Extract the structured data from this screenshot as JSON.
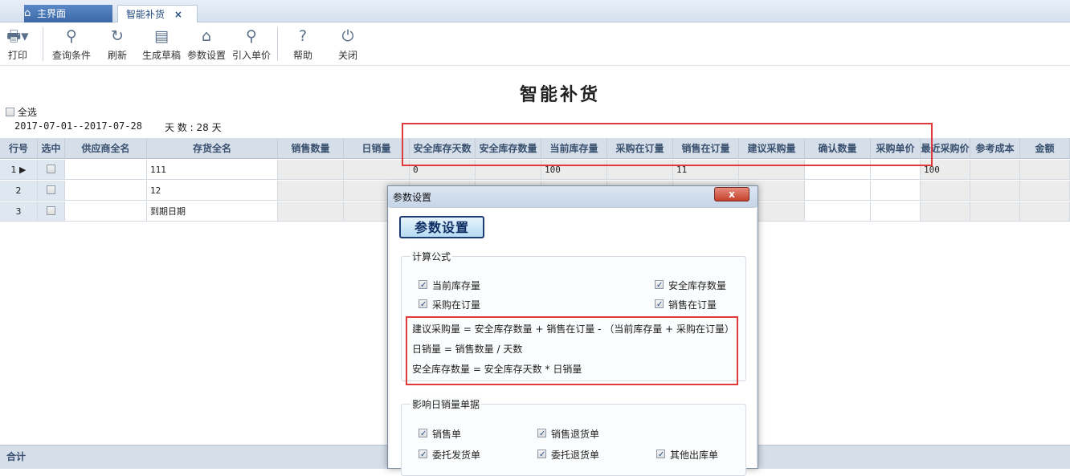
{
  "tabs": {
    "home": "主界面",
    "active": "智能补货",
    "close": "×"
  },
  "toolbar": {
    "print": "打印",
    "query": "查询条件",
    "refresh": "刷新",
    "draft": "生成草稿",
    "params": "参数设置",
    "import_price": "引入单价",
    "help": "帮助",
    "close": "关闭"
  },
  "page": {
    "title": "智能补货",
    "select_all": "全选",
    "date_range": "2017-07-01--2017-07-28",
    "days_label": "天   数 : 28 天"
  },
  "grid": {
    "columns": [
      "行号",
      "选中",
      "供应商全名",
      "存货全名",
      "销售数量",
      "日销量",
      "安全库存天数",
      "安全库存数量",
      "当前库存量",
      "采购在订量",
      "销售在订量",
      "建议采购量",
      "确认数量",
      "采购单价",
      "最近采购价",
      "参考成本",
      "金额"
    ],
    "rows": [
      {
        "no": "1",
        "supplier": "",
        "item": "111",
        "safety_days": "0",
        "current_stock": "100",
        "sales_on_order": "11",
        "recent_price": "100"
      },
      {
        "no": "2",
        "supplier": "",
        "item": "12",
        "safety_days": "",
        "current_stock": "",
        "sales_on_order": "",
        "recent_price": ""
      },
      {
        "no": "3",
        "supplier": "",
        "item": "到期日期",
        "safety_days": "",
        "current_stock": "",
        "sales_on_order": "",
        "recent_price": ""
      }
    ],
    "footer": "合计"
  },
  "dialog": {
    "title": "参数设置",
    "close": "x",
    "heading": "参数设置",
    "formula_group": {
      "title": "计算公式",
      "options": [
        {
          "label": "当前库存量",
          "checked": true
        },
        {
          "label": "安全库存数量",
          "checked": true
        },
        {
          "label": "采购在订量",
          "checked": true
        },
        {
          "label": "销售在订量",
          "checked": true
        }
      ],
      "formulas": [
        "建议采购量 = 安全库存数量 + 销售在订量 - （当前库存量 + 采购在订量）",
        "日销量 = 销售数量 / 天数",
        "安全库存数量 = 安全库存天数 * 日销量"
      ]
    },
    "docs_group": {
      "title": "影响日销量单据",
      "options": [
        {
          "label": "销售单",
          "checked": true
        },
        {
          "label": "销售退货单",
          "checked": true
        },
        {
          "label": "委托发货单",
          "checked": true
        },
        {
          "label": "委托退货单",
          "checked": true
        },
        {
          "label": "其他出库单",
          "checked": true
        }
      ]
    }
  },
  "colors": {
    "highlight": "#e03a3a",
    "header_bg": "#d5dee9",
    "accent": "#3b67a6"
  }
}
